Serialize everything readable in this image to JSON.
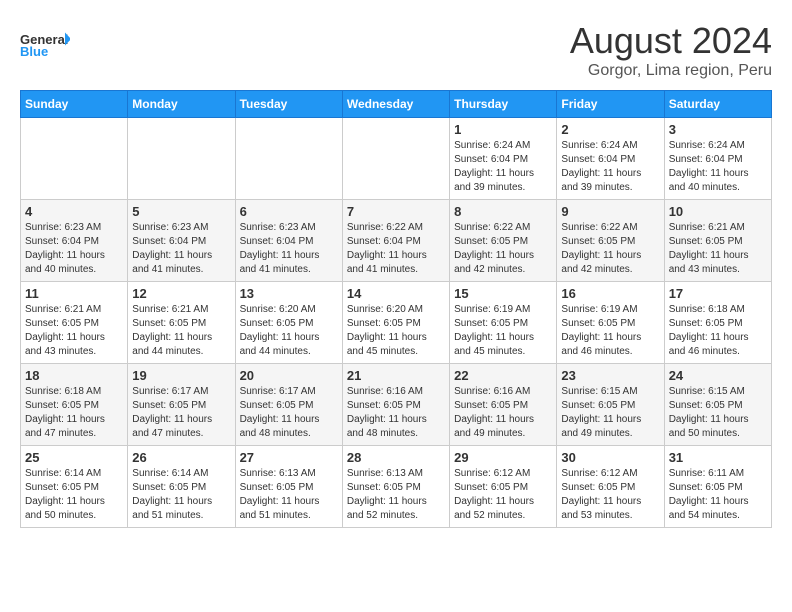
{
  "logo": {
    "line1": "General",
    "line2": "Blue"
  },
  "title": "August 2024",
  "location": "Gorgor, Lima region, Peru",
  "weekdays": [
    "Sunday",
    "Monday",
    "Tuesday",
    "Wednesday",
    "Thursday",
    "Friday",
    "Saturday"
  ],
  "weeks": [
    [
      {
        "day": "",
        "info": ""
      },
      {
        "day": "",
        "info": ""
      },
      {
        "day": "",
        "info": ""
      },
      {
        "day": "",
        "info": ""
      },
      {
        "day": "1",
        "info": "Sunrise: 6:24 AM\nSunset: 6:04 PM\nDaylight: 11 hours\nand 39 minutes."
      },
      {
        "day": "2",
        "info": "Sunrise: 6:24 AM\nSunset: 6:04 PM\nDaylight: 11 hours\nand 39 minutes."
      },
      {
        "day": "3",
        "info": "Sunrise: 6:24 AM\nSunset: 6:04 PM\nDaylight: 11 hours\nand 40 minutes."
      }
    ],
    [
      {
        "day": "4",
        "info": "Sunrise: 6:23 AM\nSunset: 6:04 PM\nDaylight: 11 hours\nand 40 minutes."
      },
      {
        "day": "5",
        "info": "Sunrise: 6:23 AM\nSunset: 6:04 PM\nDaylight: 11 hours\nand 41 minutes."
      },
      {
        "day": "6",
        "info": "Sunrise: 6:23 AM\nSunset: 6:04 PM\nDaylight: 11 hours\nand 41 minutes."
      },
      {
        "day": "7",
        "info": "Sunrise: 6:22 AM\nSunset: 6:04 PM\nDaylight: 11 hours\nand 41 minutes."
      },
      {
        "day": "8",
        "info": "Sunrise: 6:22 AM\nSunset: 6:05 PM\nDaylight: 11 hours\nand 42 minutes."
      },
      {
        "day": "9",
        "info": "Sunrise: 6:22 AM\nSunset: 6:05 PM\nDaylight: 11 hours\nand 42 minutes."
      },
      {
        "day": "10",
        "info": "Sunrise: 6:21 AM\nSunset: 6:05 PM\nDaylight: 11 hours\nand 43 minutes."
      }
    ],
    [
      {
        "day": "11",
        "info": "Sunrise: 6:21 AM\nSunset: 6:05 PM\nDaylight: 11 hours\nand 43 minutes."
      },
      {
        "day": "12",
        "info": "Sunrise: 6:21 AM\nSunset: 6:05 PM\nDaylight: 11 hours\nand 44 minutes."
      },
      {
        "day": "13",
        "info": "Sunrise: 6:20 AM\nSunset: 6:05 PM\nDaylight: 11 hours\nand 44 minutes."
      },
      {
        "day": "14",
        "info": "Sunrise: 6:20 AM\nSunset: 6:05 PM\nDaylight: 11 hours\nand 45 minutes."
      },
      {
        "day": "15",
        "info": "Sunrise: 6:19 AM\nSunset: 6:05 PM\nDaylight: 11 hours\nand 45 minutes."
      },
      {
        "day": "16",
        "info": "Sunrise: 6:19 AM\nSunset: 6:05 PM\nDaylight: 11 hours\nand 46 minutes."
      },
      {
        "day": "17",
        "info": "Sunrise: 6:18 AM\nSunset: 6:05 PM\nDaylight: 11 hours\nand 46 minutes."
      }
    ],
    [
      {
        "day": "18",
        "info": "Sunrise: 6:18 AM\nSunset: 6:05 PM\nDaylight: 11 hours\nand 47 minutes."
      },
      {
        "day": "19",
        "info": "Sunrise: 6:17 AM\nSunset: 6:05 PM\nDaylight: 11 hours\nand 47 minutes."
      },
      {
        "day": "20",
        "info": "Sunrise: 6:17 AM\nSunset: 6:05 PM\nDaylight: 11 hours\nand 48 minutes."
      },
      {
        "day": "21",
        "info": "Sunrise: 6:16 AM\nSunset: 6:05 PM\nDaylight: 11 hours\nand 48 minutes."
      },
      {
        "day": "22",
        "info": "Sunrise: 6:16 AM\nSunset: 6:05 PM\nDaylight: 11 hours\nand 49 minutes."
      },
      {
        "day": "23",
        "info": "Sunrise: 6:15 AM\nSunset: 6:05 PM\nDaylight: 11 hours\nand 49 minutes."
      },
      {
        "day": "24",
        "info": "Sunrise: 6:15 AM\nSunset: 6:05 PM\nDaylight: 11 hours\nand 50 minutes."
      }
    ],
    [
      {
        "day": "25",
        "info": "Sunrise: 6:14 AM\nSunset: 6:05 PM\nDaylight: 11 hours\nand 50 minutes."
      },
      {
        "day": "26",
        "info": "Sunrise: 6:14 AM\nSunset: 6:05 PM\nDaylight: 11 hours\nand 51 minutes."
      },
      {
        "day": "27",
        "info": "Sunrise: 6:13 AM\nSunset: 6:05 PM\nDaylight: 11 hours\nand 51 minutes."
      },
      {
        "day": "28",
        "info": "Sunrise: 6:13 AM\nSunset: 6:05 PM\nDaylight: 11 hours\nand 52 minutes."
      },
      {
        "day": "29",
        "info": "Sunrise: 6:12 AM\nSunset: 6:05 PM\nDaylight: 11 hours\nand 52 minutes."
      },
      {
        "day": "30",
        "info": "Sunrise: 6:12 AM\nSunset: 6:05 PM\nDaylight: 11 hours\nand 53 minutes."
      },
      {
        "day": "31",
        "info": "Sunrise: 6:11 AM\nSunset: 6:05 PM\nDaylight: 11 hours\nand 54 minutes."
      }
    ]
  ]
}
